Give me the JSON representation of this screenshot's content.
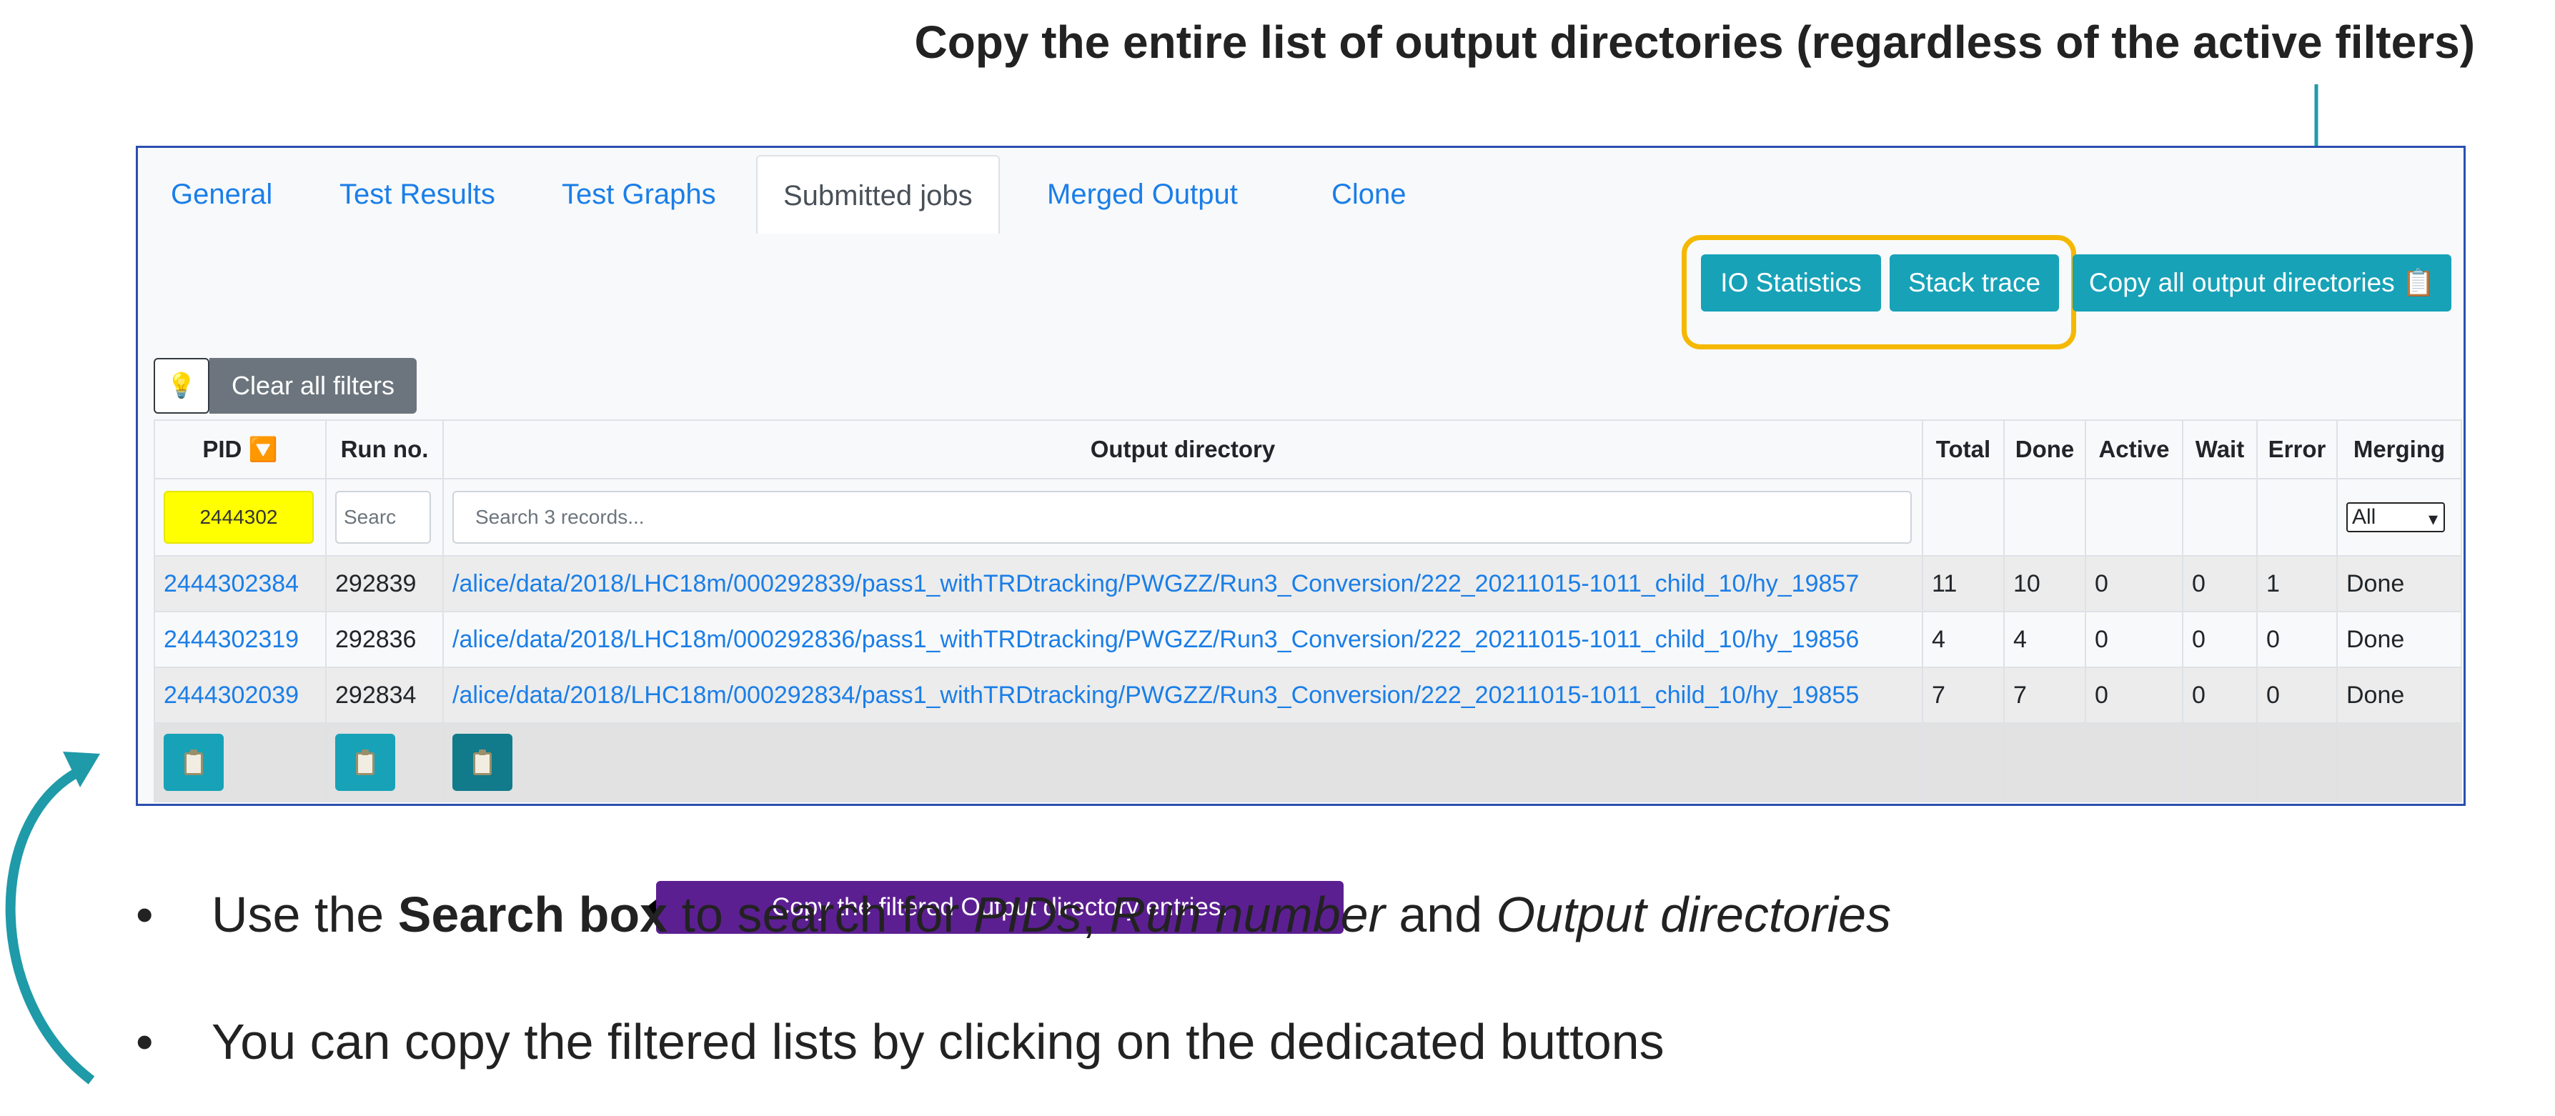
{
  "annotation": {
    "top_text": "Copy the entire list of output directories (regardless of the active filters)",
    "tooltip": "Copy the filtered Output directory entries."
  },
  "tabs": [
    {
      "label": "General",
      "active": false
    },
    {
      "label": "Test Results",
      "active": false
    },
    {
      "label": "Test Graphs",
      "active": false
    },
    {
      "label": "Submitted jobs",
      "active": true
    },
    {
      "label": "Merged Output",
      "active": false
    },
    {
      "label": "Clone",
      "active": false
    }
  ],
  "toolbar": {
    "io_statistics": "IO Statistics",
    "stack_trace": "Stack trace",
    "copy_all": "Copy all output directories 📋",
    "bulb": "💡",
    "clear_filters": "Clear all filters"
  },
  "table": {
    "headers": {
      "pid": "PID",
      "pid_sort": "🔽",
      "run": "Run no.",
      "outdir": "Output directory",
      "total": "Total",
      "done": "Done",
      "active": "Active",
      "wait": "Wait",
      "error": "Error",
      "merging": "Merging"
    },
    "filters": {
      "pid_value": "2444302",
      "run_placeholder": "Searc",
      "outdir_placeholder": "Search 3 records...",
      "merging_value": "All"
    },
    "rows": [
      {
        "pid": "2444302384",
        "run": "292839",
        "outdir": "/alice/data/2018/LHC18m/000292839/pass1_withTRDtracking/PWGZZ/Run3_Conversion/222_20211015-1011_child_10/hy_19857",
        "total": "11",
        "done": "10",
        "active": "0",
        "wait": "0",
        "error": "1",
        "merging": "Done"
      },
      {
        "pid": "2444302319",
        "run": "292836",
        "outdir": "/alice/data/2018/LHC18m/000292836/pass1_withTRDtracking/PWGZZ/Run3_Conversion/222_20211015-1011_child_10/hy_19856",
        "total": "4",
        "done": "4",
        "active": "0",
        "wait": "0",
        "error": "0",
        "merging": "Done"
      },
      {
        "pid": "2444302039",
        "run": "292834",
        "outdir": "/alice/data/2018/LHC18m/000292834/pass1_withTRDtracking/PWGZZ/Run3_Conversion/222_20211015-1011_child_10/hy_19855",
        "total": "7",
        "done": "7",
        "active": "0",
        "wait": "0",
        "error": "0",
        "merging": "Done"
      }
    ]
  },
  "bullets": [
    {
      "pre": "Use the ",
      "bold": "Search box",
      "mid1": " to search for ",
      "i1": "PIDs",
      "mid2": ", ",
      "i2": "Run number",
      "mid3": " and ",
      "i3": "Output directories"
    },
    {
      "text": "You can copy the filtered lists by clicking on the dedicated buttons"
    }
  ],
  "bullet_char": "•",
  "colors": {
    "accent": "#17a2b8",
    "highlight": "#f5b800",
    "tooltip": "#5c1f91",
    "link": "#1a7ee8",
    "frame": "#2b4fb0"
  }
}
